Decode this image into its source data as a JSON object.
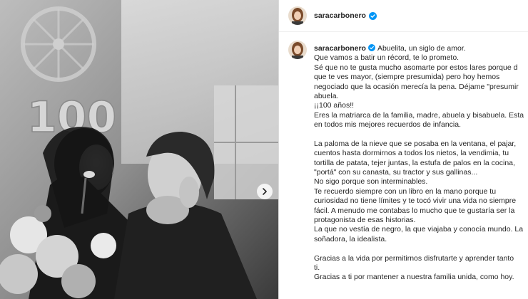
{
  "post": {
    "username": "saracarbonero",
    "verified_icon": "verified-badge-icon",
    "photo_text": "100",
    "caption_lines": [
      "Abuelita, un siglo de amor.",
      "Que vamos a batir un récord, te lo prometo.",
      "Sé que no te gusta mucho asomarte por estos lares porque d",
      "que te ves mayor, (siempre presumida) pero hoy hemos",
      "negociado que la ocasión merecía la pena. Déjame \"presumir",
      "abuela.",
      "¡¡100 años!!",
      "Eres la matriarca de la familia, madre, abuela y bisabuela. Esta",
      "en todos mis mejores recuerdos de infancia.",
      "",
      "La paloma de la nieve que se posaba en la ventana, el pajar,",
      "cuentos hasta dormirnos a todos los nietos, la vendimia, tu",
      "tortilla de patata, tejer juntas, la estufa de palos en la cocina,",
      "\"portá\" con su canasta, su tractor y sus gallinas...",
      "No sigo porque son interminables.",
      "Te recuerdo siempre con un libro en la mano porque tu",
      "curiosidad no tiene límites y te tocó vivir una vida no siempre",
      "fácil. A menudo me contabas lo mucho que te gustaría ser la",
      "protagonista de esas historias.",
      "La que no vestía de negro, la que viajaba y conocía mundo. La",
      "soñadora, la idealista.",
      "",
      "Gracias a la vida por permitirnos disfrutarte y aprender tanto",
      "ti.",
      "Gracias a ti por mantener a nuestra familia unida, como hoy."
    ]
  },
  "icons": {
    "next": "chevron-right-icon"
  }
}
